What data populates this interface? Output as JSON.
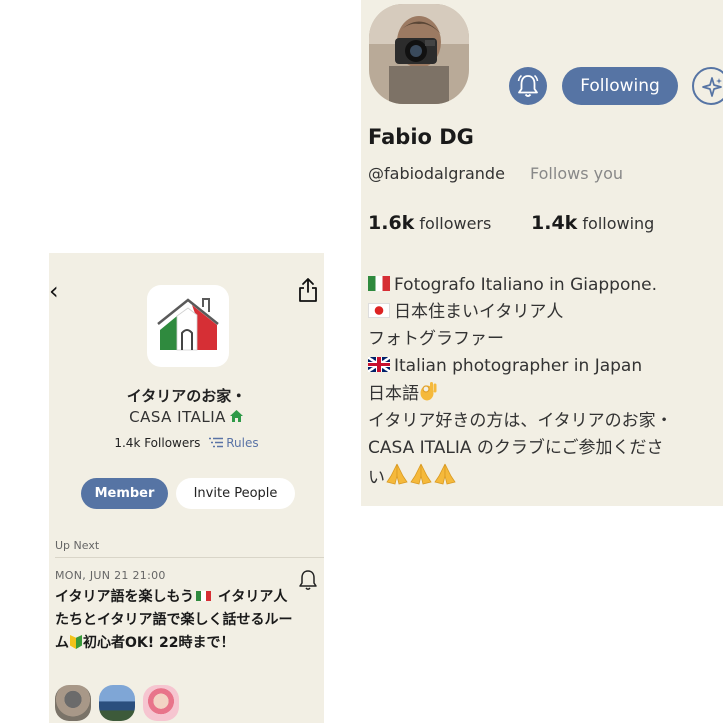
{
  "club_page": {
    "title": "イタリアのお家・",
    "subtitle": "CASA ITALIA",
    "followers": "1.4k Followers",
    "rules_label": "Rules",
    "member_button": "Member",
    "invite_button": "Invite People",
    "up_next_label": "Up Next",
    "event": {
      "time": "MON, JUN 21 21:00",
      "title_part1": "イタリア語を楽しもう",
      "title_part2": " イタリア人たちとイタリア語で楽しく話せるルーム",
      "title_part3": "初心者OK! 22時まで！"
    },
    "icons": [
      "back-chevron-icon",
      "share-icon",
      "house-logo-icon",
      "house-icon",
      "list-icon",
      "bell-icon",
      "italy-flag-icon",
      "beginner-mark-icon"
    ],
    "colors": {
      "background": "#f2efe4",
      "accent": "#5674a4",
      "rules": "#5a73a6"
    }
  },
  "profile": {
    "name": "Fabio DG",
    "handle": "@fabiodalgrande",
    "follows_you": "Follows you",
    "followers_count": "1.6k",
    "followers_label": "followers",
    "following_count": "1.4k",
    "following_label": "following",
    "following_button": "Following",
    "bio": {
      "line1": "Fotografo Italiano in Giappone.",
      "line2": "日本住まいイタリア人",
      "line3": "フォトグラファー",
      "line4": "Italian photographer in Japan",
      "line5": "日本語",
      "line6": "イタリア好きの方は、イタリアのお家・",
      "line7": "CASA ITALIA のクラブにご参加くださ",
      "line8": "い"
    },
    "icons": [
      "bell-icon",
      "sparkle-icon",
      "italy-flag-icon",
      "japan-flag-icon",
      "uk-flag-icon",
      "ok-hand-icon",
      "praying-hands-icon"
    ]
  }
}
